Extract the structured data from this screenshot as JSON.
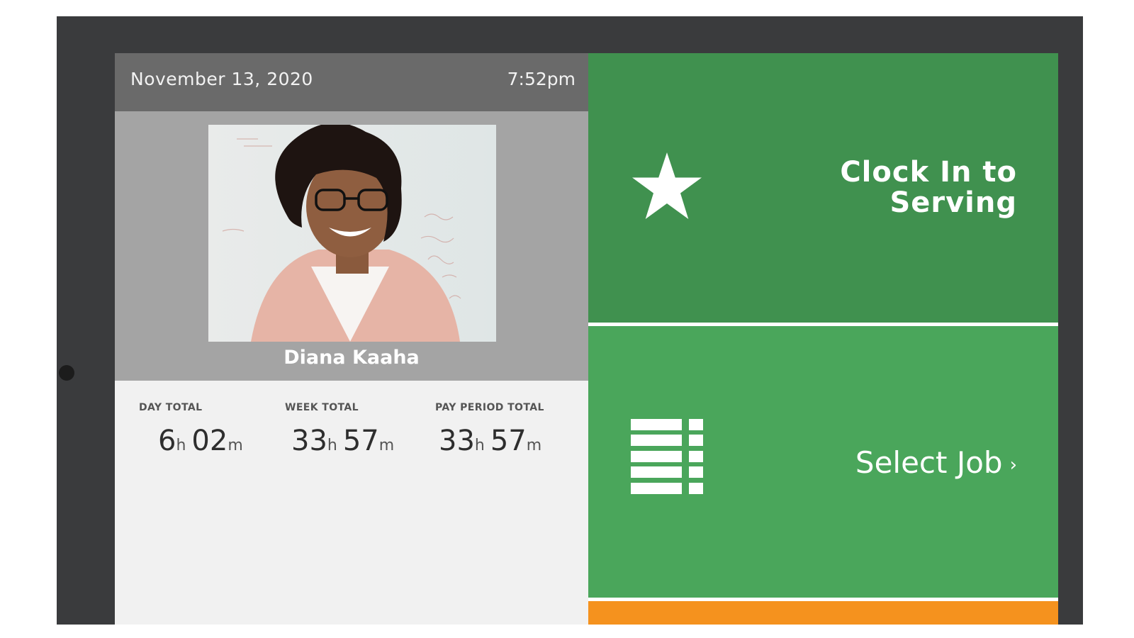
{
  "header": {
    "date": "November 13, 2020",
    "time": "7:52pm"
  },
  "employee": {
    "name": "Diana Kaaha"
  },
  "totals": [
    {
      "label": "DAY TOTAL",
      "hours": "6",
      "minutes": "02",
      "h_unit": "h",
      "m_unit": "m"
    },
    {
      "label": "WEEK TOTAL",
      "hours": "33",
      "minutes": "57",
      "h_unit": "h",
      "m_unit": "m"
    },
    {
      "label": "PAY PERIOD TOTAL",
      "hours": "33",
      "minutes": "57",
      "h_unit": "h",
      "m_unit": "m"
    }
  ],
  "actions": {
    "clock_in_line1": "Clock In to",
    "clock_in_line2": "Serving",
    "select_job": "Select Job",
    "select_job_chevron": "›"
  },
  "icons": {
    "clock_in": "star-icon",
    "select_job": "list-icon"
  },
  "colors": {
    "clock_in_bg": "#40914f",
    "select_job_bg": "#4aa65b",
    "orange_bar": "#f5921e",
    "header_bg": "#6a6a6a"
  }
}
